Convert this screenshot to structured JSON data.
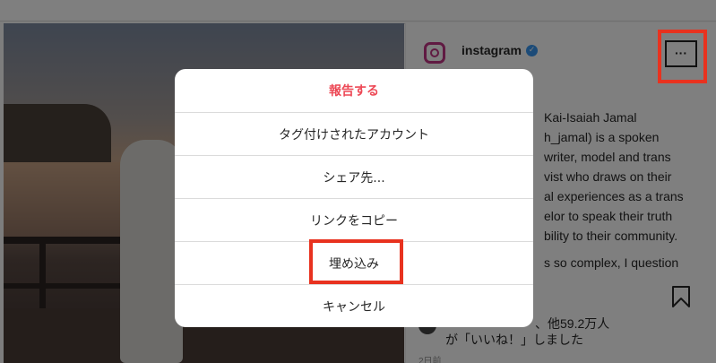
{
  "account": {
    "name": "instagram",
    "verified": "✓"
  },
  "post": {
    "caption_lines": [
      "Kai-Isaiah Jamal",
      "h_jamal) is a spoken",
      "writer, model and trans",
      "vist who draws on their",
      "al experiences as a trans",
      "elor to speak their truth",
      "bility to their community."
    ],
    "caption_more": "s so complex, I question",
    "likes_line1": "、他59.2万人",
    "likes_line2": "が「いいね！」しました",
    "date": "2日前"
  },
  "more_button": {
    "label": "···"
  },
  "modal": {
    "items": [
      {
        "label": "報告する",
        "style": "danger"
      },
      {
        "label": "タグ付けされたアカウント"
      },
      {
        "label": "シェア先..."
      },
      {
        "label": "リンクをコピー"
      },
      {
        "label": "埋め込み"
      },
      {
        "label": "キャンセル"
      }
    ]
  },
  "colors": {
    "danger": "#ed4956",
    "highlight": "#e8321f",
    "verified": "#3897f0"
  },
  "icons": [
    "instagram-logo-icon",
    "verified-badge-icon",
    "more-options-icon",
    "bookmark-icon"
  ]
}
